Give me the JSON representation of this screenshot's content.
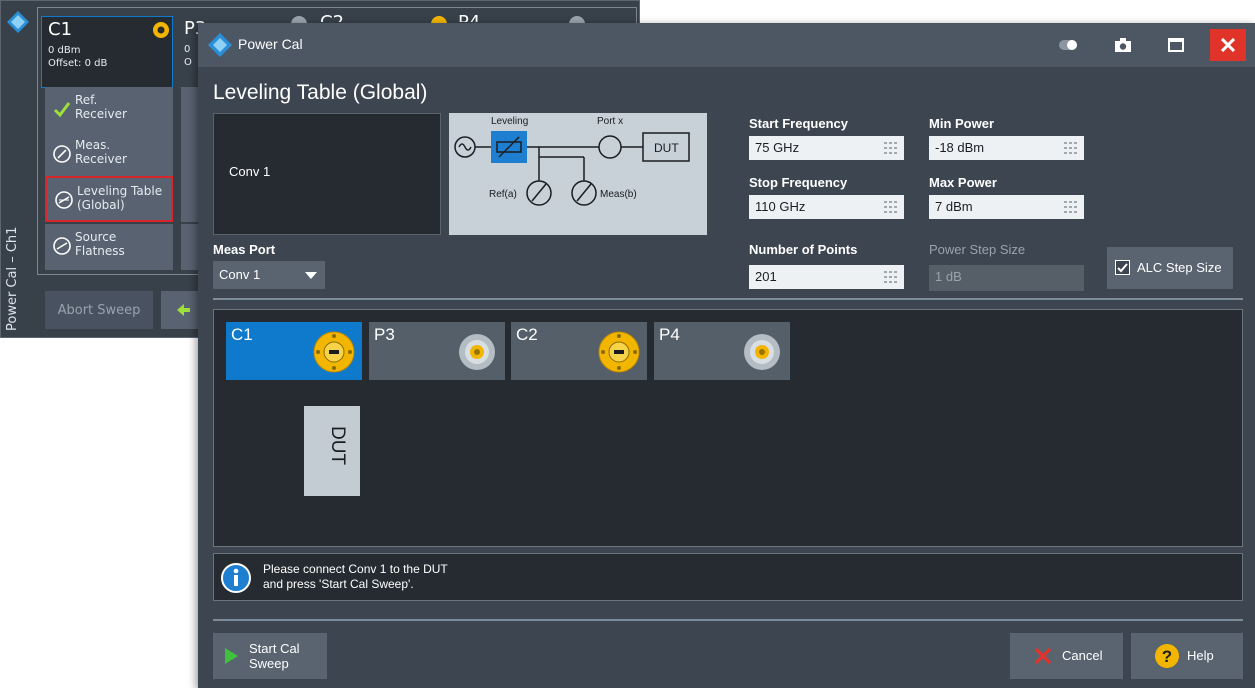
{
  "background_panel": {
    "vertical_label": "Power Cal – Ch1",
    "ports": [
      {
        "name": "C1",
        "lines": [
          "0 dBm",
          "Offset: 0 dB"
        ]
      },
      {
        "name": "P3",
        "lines": [
          "0",
          "O"
        ]
      },
      {
        "name": "C2",
        "lines": []
      },
      {
        "name": "P4",
        "lines": []
      }
    ],
    "buttons": [
      {
        "label_line1": "Ref.",
        "label_line2": "Receiver"
      },
      {
        "label_line1": "Meas.",
        "label_line2": "Receiver"
      },
      {
        "label_line1": "Leveling Table",
        "label_line2": "(Global)"
      },
      {
        "label_line1": "Source",
        "label_line2": "Flatness"
      }
    ],
    "abort_label": "Abort Sweep"
  },
  "dialog": {
    "title": "Power Cal",
    "heading": "Leveling Table (Global)",
    "conv_label": "Conv 1",
    "schematic": {
      "leveling_label": "Leveling",
      "port_label": "Port x",
      "dut_label": "DUT",
      "ref_label": "Ref(a)",
      "meas_label": "Meas(b)"
    },
    "fields": {
      "start_frequency": {
        "label": "Start Frequency",
        "value": "75 GHz"
      },
      "stop_frequency": {
        "label": "Stop Frequency",
        "value": "110 GHz"
      },
      "number_of_points": {
        "label": "Number of Points",
        "value": "201"
      },
      "min_power": {
        "label": "Min Power",
        "value": "-18 dBm"
      },
      "max_power": {
        "label": "Max Power",
        "value": "7 dBm"
      },
      "power_step_size": {
        "label": "Power Step Size",
        "value": "1 dB"
      }
    },
    "meas_port": {
      "label": "Meas Port",
      "selected": "Conv 1"
    },
    "alc_step_size": {
      "label": "ALC Step Size",
      "checked": true
    },
    "ports": [
      {
        "name": "C1",
        "type": "converter",
        "selected": true
      },
      {
        "name": "P3",
        "type": "coax",
        "selected": false
      },
      {
        "name": "C2",
        "type": "converter",
        "selected": false
      },
      {
        "name": "P4",
        "type": "coax",
        "selected": false
      }
    ],
    "dut_label": "DUT",
    "info_line1": "Please connect Conv 1 to the DUT",
    "info_line2": "and press 'Start Cal Sweep'.",
    "start_label_line1": "Start Cal",
    "start_label_line2": "Sweep",
    "cancel_label": "Cancel",
    "help_label": "Help"
  },
  "colors": {
    "dialog_bg": "#3d4550",
    "titlebar": "#4d5764",
    "accent_blue": "#0f7acb",
    "close_red": "#e0342a",
    "highlight_red": "#d8262c",
    "converter_yellow": "#f2b600"
  }
}
